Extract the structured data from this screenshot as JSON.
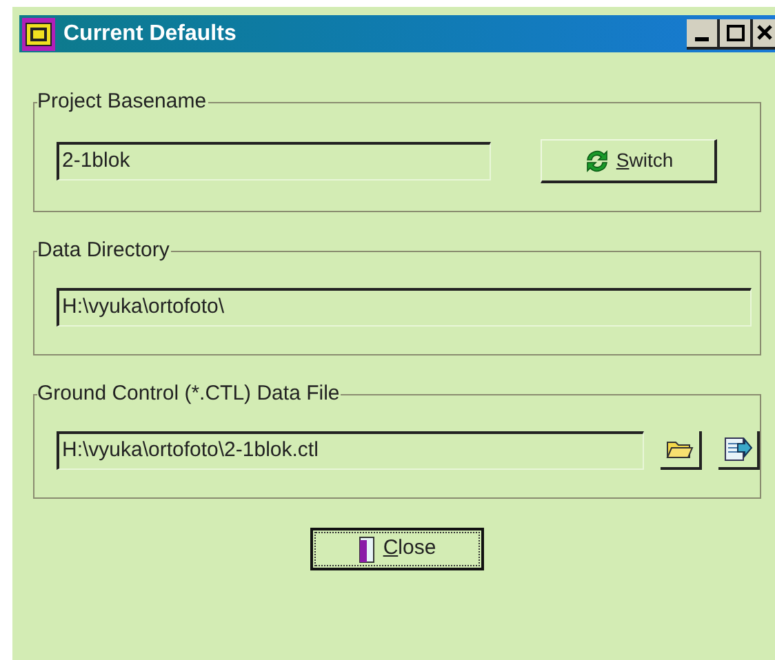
{
  "window": {
    "title": "Current Defaults"
  },
  "groups": [
    {
      "kind": "basename",
      "label": "Project Basename",
      "value": "2-1blok",
      "button": "Switch"
    },
    {
      "kind": "directory",
      "label": "Data Directory",
      "value": "H:\\vyuka\\ortofoto\\"
    },
    {
      "kind": "file",
      "label": "Ground Control (*.CTL) Data File",
      "value": "H:\\vyuka\\ortofoto\\2-1blok.ctl"
    }
  ],
  "close_button": "Close"
}
